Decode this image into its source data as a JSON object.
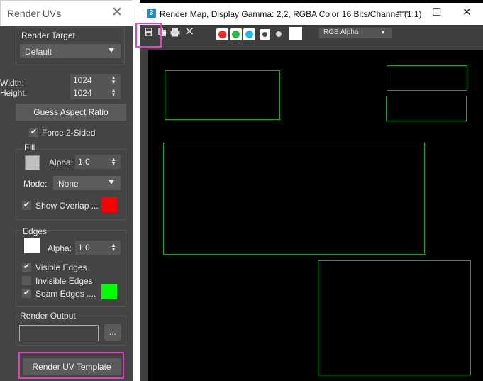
{
  "left_panel": {
    "title": "Render UVs",
    "close_glyph": "✕",
    "render_target": {
      "label": "Render Target",
      "value": "Default"
    },
    "width": {
      "label": "Width:",
      "value": "1024"
    },
    "height": {
      "label": "Height:",
      "value": "1024"
    },
    "guess_aspect_label": "Guess Aspect Ratio",
    "force_two_sided": {
      "label": "Force 2-Sided",
      "checked": true
    },
    "fill": {
      "label": "Fill",
      "alpha_label": "Alpha:",
      "alpha_value": "1,0",
      "mode_label": "Mode:",
      "mode_value": "None",
      "show_overlap": {
        "label": "Show Overlap ...",
        "checked": true
      },
      "swatch_color": "#c0c0c0",
      "overlap_color": "#ff0000"
    },
    "edges": {
      "label": "Edges",
      "alpha_label": "Alpha:",
      "alpha_value": "1,0",
      "swatch_color": "#ffffff",
      "visible_edges": {
        "label": "Visible Edges",
        "checked": true
      },
      "invisible_edges": {
        "label": "Invisible Edges",
        "checked": false
      },
      "seam_edges": {
        "label": "Seam Edges ....",
        "checked": true
      },
      "seam_color": "#00ff00"
    },
    "render_output": {
      "label": "Render Output",
      "value": "",
      "browse_label": "..."
    },
    "render_uv_template_label": "Render UV Template"
  },
  "right_window": {
    "title": "Render Map, Display Gamma: 2,2, RGBA Color 16 Bits/Channel (1:1)",
    "app_icon_text": "3",
    "controls": {
      "minimize": "—",
      "maximize": "☐",
      "close": "✕"
    },
    "toolbar": {
      "save_icon": "save-icon",
      "copy_icon": "copy-icon",
      "print_icon": "print-icon",
      "clear_icon": "clear-icon",
      "channel_colors": {
        "red": "#ff2020",
        "green": "#20c040",
        "blue": "#20b8f0"
      },
      "channel_select": "RGB Alpha"
    },
    "uv_edge_color": "#1fa51f"
  }
}
